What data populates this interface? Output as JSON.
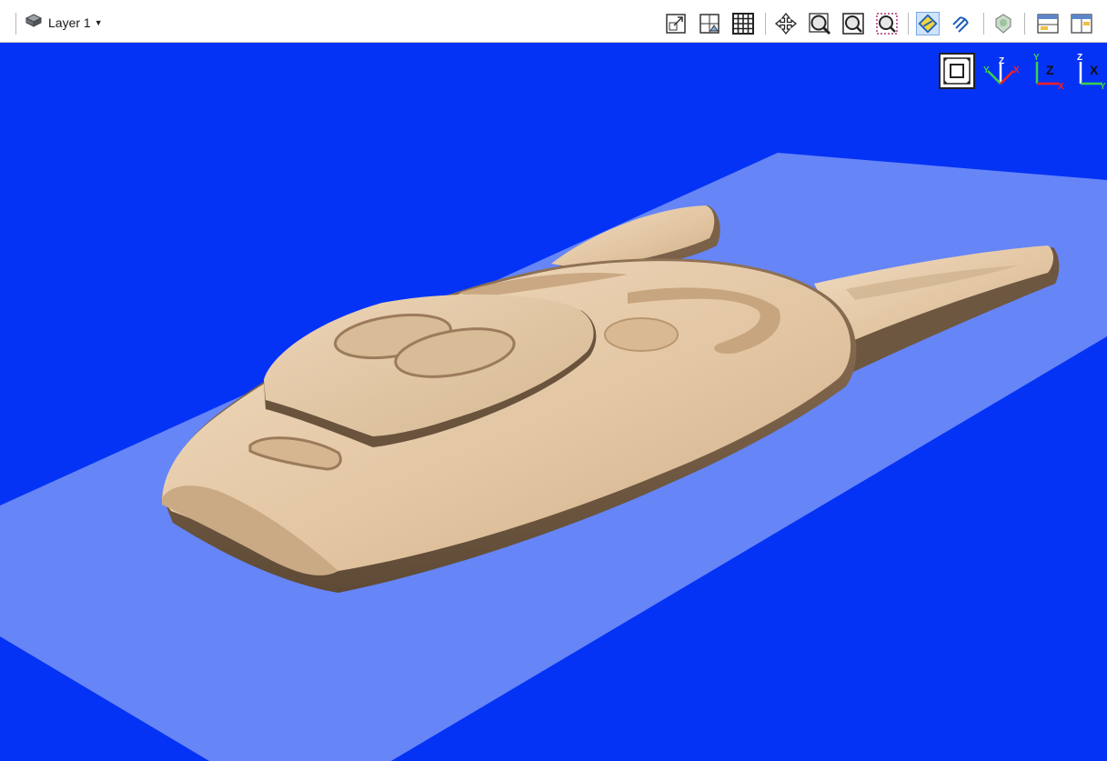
{
  "toolbar": {
    "layer_label": "Layer 1",
    "layer_icon": "layer-stack-icon",
    "buttons": [
      {
        "name": "scale-view-button",
        "icon": "scale-icon"
      },
      {
        "name": "toggle-2d-3d-button",
        "icon": "view-2d-icon"
      },
      {
        "name": "grid-toggle-button",
        "icon": "grid-icon"
      },
      {
        "name": "pan-button",
        "icon": "pan-move-icon"
      },
      {
        "name": "zoom-extents-button",
        "icon": "zoom-extents-icon"
      },
      {
        "name": "zoom-window-button",
        "icon": "zoom-window-icon"
      },
      {
        "name": "zoom-selection-button",
        "icon": "zoom-selection-icon"
      },
      {
        "name": "show-vectors-button",
        "icon": "vectors-icon",
        "active": true
      },
      {
        "name": "toolpath-view-button",
        "icon": "toolpath-icon"
      },
      {
        "name": "render-shading-button",
        "icon": "shading-icon"
      },
      {
        "name": "split-view-button",
        "icon": "split-view-icon"
      },
      {
        "name": "window-layout-button",
        "icon": "layout-icon"
      }
    ]
  },
  "viewport": {
    "background_color": "#0533f5",
    "material_color": "#e3c5a2",
    "sheet_color": "#6f8cf5",
    "view_buttons": [
      {
        "name": "view-fit-button",
        "icon": "fit-view-icon"
      },
      {
        "name": "view-iso-button",
        "icon": "iso-axes-icon",
        "labels": [
          "Z",
          "Y",
          "X"
        ]
      },
      {
        "name": "view-top-button",
        "icon": "top-axes-icon",
        "labels": [
          "Y",
          "Z",
          "X"
        ]
      },
      {
        "name": "view-front-button",
        "icon": "front-axes-icon",
        "labels": [
          "Z",
          "X",
          "Y"
        ]
      }
    ]
  }
}
